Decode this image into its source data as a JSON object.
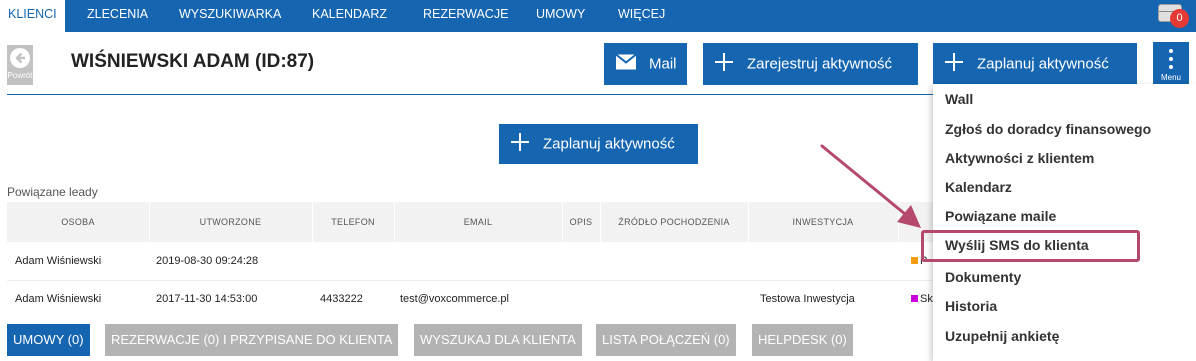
{
  "topnav": {
    "tabs": [
      {
        "label": "KLIENCI",
        "active": true
      },
      {
        "label": "ZLECENIA"
      },
      {
        "label": "WYSZUKIWARKA"
      },
      {
        "label": "KALENDARZ"
      },
      {
        "label": "REZERWACJE"
      },
      {
        "label": "UMOWY"
      },
      {
        "label": "WIĘCEJ"
      }
    ],
    "notification_count": "0"
  },
  "header": {
    "back_label": "Powrót",
    "title": "WIŚNIEWSKI ADAM (ID:87)",
    "mail_label": "Mail",
    "register_activity_label": "Zarejestruj aktywność",
    "plan_activity_label": "Zaplanuj aktywność",
    "menu_label": "Menu"
  },
  "main": {
    "plan_activity_label": "Zaplanuj aktywność"
  },
  "leads": {
    "title": "Powiązane leady",
    "columns": [
      "OSOBA",
      "UTWORZONE",
      "TELEFON",
      "EMAIL",
      "OPIS",
      "ŹRÓDŁO POCHODZENIA",
      "INWESTYCJA"
    ],
    "rows": [
      {
        "osoba": "Adam Wiśniewski",
        "utworzone": "2019-08-30 09:24:28",
        "telefon": "",
        "email": "",
        "opis": "",
        "zrodlo": "",
        "inwestycja": "",
        "status": "P",
        "status_color": "#f39c12"
      },
      {
        "osoba": "Adam Wiśniewski",
        "utworzone": "2017-11-30 14:53:00",
        "telefon": "4433222",
        "email": "test@voxcommerce.pl",
        "opis": "",
        "zrodlo": "",
        "inwestycja": "Testowa Inwestycja",
        "status": "Sk",
        "status_color": "#c800d9"
      }
    ]
  },
  "bottom_tabs": [
    {
      "label": "UMOWY (0)",
      "active": true
    },
    {
      "label": "REZERWACJE (0) I PRZYPISANE DO KLIENTA"
    },
    {
      "label": "WYSZUKAJ DLA KLIENTA"
    },
    {
      "label": "LISTA POŁĄCZEŃ (0)"
    },
    {
      "label": "HELPDESK (0)"
    }
  ],
  "menu": {
    "items": [
      {
        "label": "Wall"
      },
      {
        "label": "Zgłoś do doradcy finansowego"
      },
      {
        "label": "Aktywności z klientem"
      },
      {
        "label": "Kalendarz"
      },
      {
        "label": "Powiązane maile"
      },
      {
        "label": "Wyślij SMS do klienta",
        "highlighted": true
      },
      {
        "label": "Dokumenty"
      },
      {
        "label": "Historia"
      },
      {
        "label": "Uzupełnij ankietę"
      }
    ]
  },
  "colors": {
    "primary": "#1565b0",
    "inactive_button": "#b3b3b3",
    "highlight": "#b5496d",
    "badge": "#e53935"
  },
  "icons": {
    "back": "arrow-left-circle-icon",
    "mail": "envelope-icon",
    "plus": "plus-icon",
    "menu": "vertical-dots-icon",
    "notifications": "inbox-icon"
  }
}
